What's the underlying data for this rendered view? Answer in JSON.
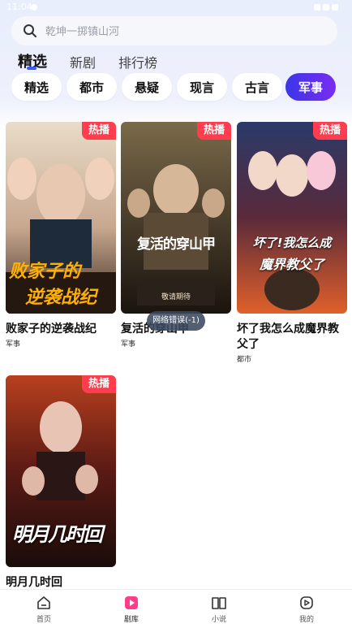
{
  "status": {
    "time": "11:04"
  },
  "search": {
    "placeholder": "乾坤一掷镇山河"
  },
  "tabs": [
    {
      "label": "精选"
    },
    {
      "label": "新剧"
    },
    {
      "label": "排行榜"
    }
  ],
  "chips": [
    {
      "label": "精选"
    },
    {
      "label": "都市"
    },
    {
      "label": "悬疑"
    },
    {
      "label": "现言"
    },
    {
      "label": "古言"
    },
    {
      "label": "军事"
    }
  ],
  "cards": [
    {
      "title": "败家子的逆袭战纪",
      "tag": "军事",
      "badge": "热播",
      "poster_text": "败家子的",
      "poster_text2": "逆袭战纪"
    },
    {
      "title": "复活的穿山甲",
      "tag": "军事",
      "badge": "热播",
      "poster_text": "复活的穿山甲",
      "poster_text2": "敬请期待"
    },
    {
      "title": "坏了我怎么成魔界教父了",
      "tag": "都市",
      "badge": "热播",
      "poster_text": "坏了!我怎么成",
      "poster_text2": "魔界教父了"
    },
    {
      "title": "明月几时回",
      "tag": "",
      "badge": "热播",
      "poster_text": "明月几时回",
      "poster_text2": ""
    }
  ],
  "toast": "网络错误(-1)",
  "nav": [
    {
      "label": "首页",
      "icon": "home-icon"
    },
    {
      "label": "剧库",
      "icon": "play-icon"
    },
    {
      "label": "小说",
      "icon": "book-icon"
    },
    {
      "label": "我的",
      "icon": "profile-icon"
    }
  ],
  "colors": {
    "accent": "#3b5bfd",
    "chip_active_start": "#3a37e6",
    "chip_active_end": "#7a2cf0",
    "badge": "#ff3d4f",
    "nav_active": "#ff3d8a"
  }
}
